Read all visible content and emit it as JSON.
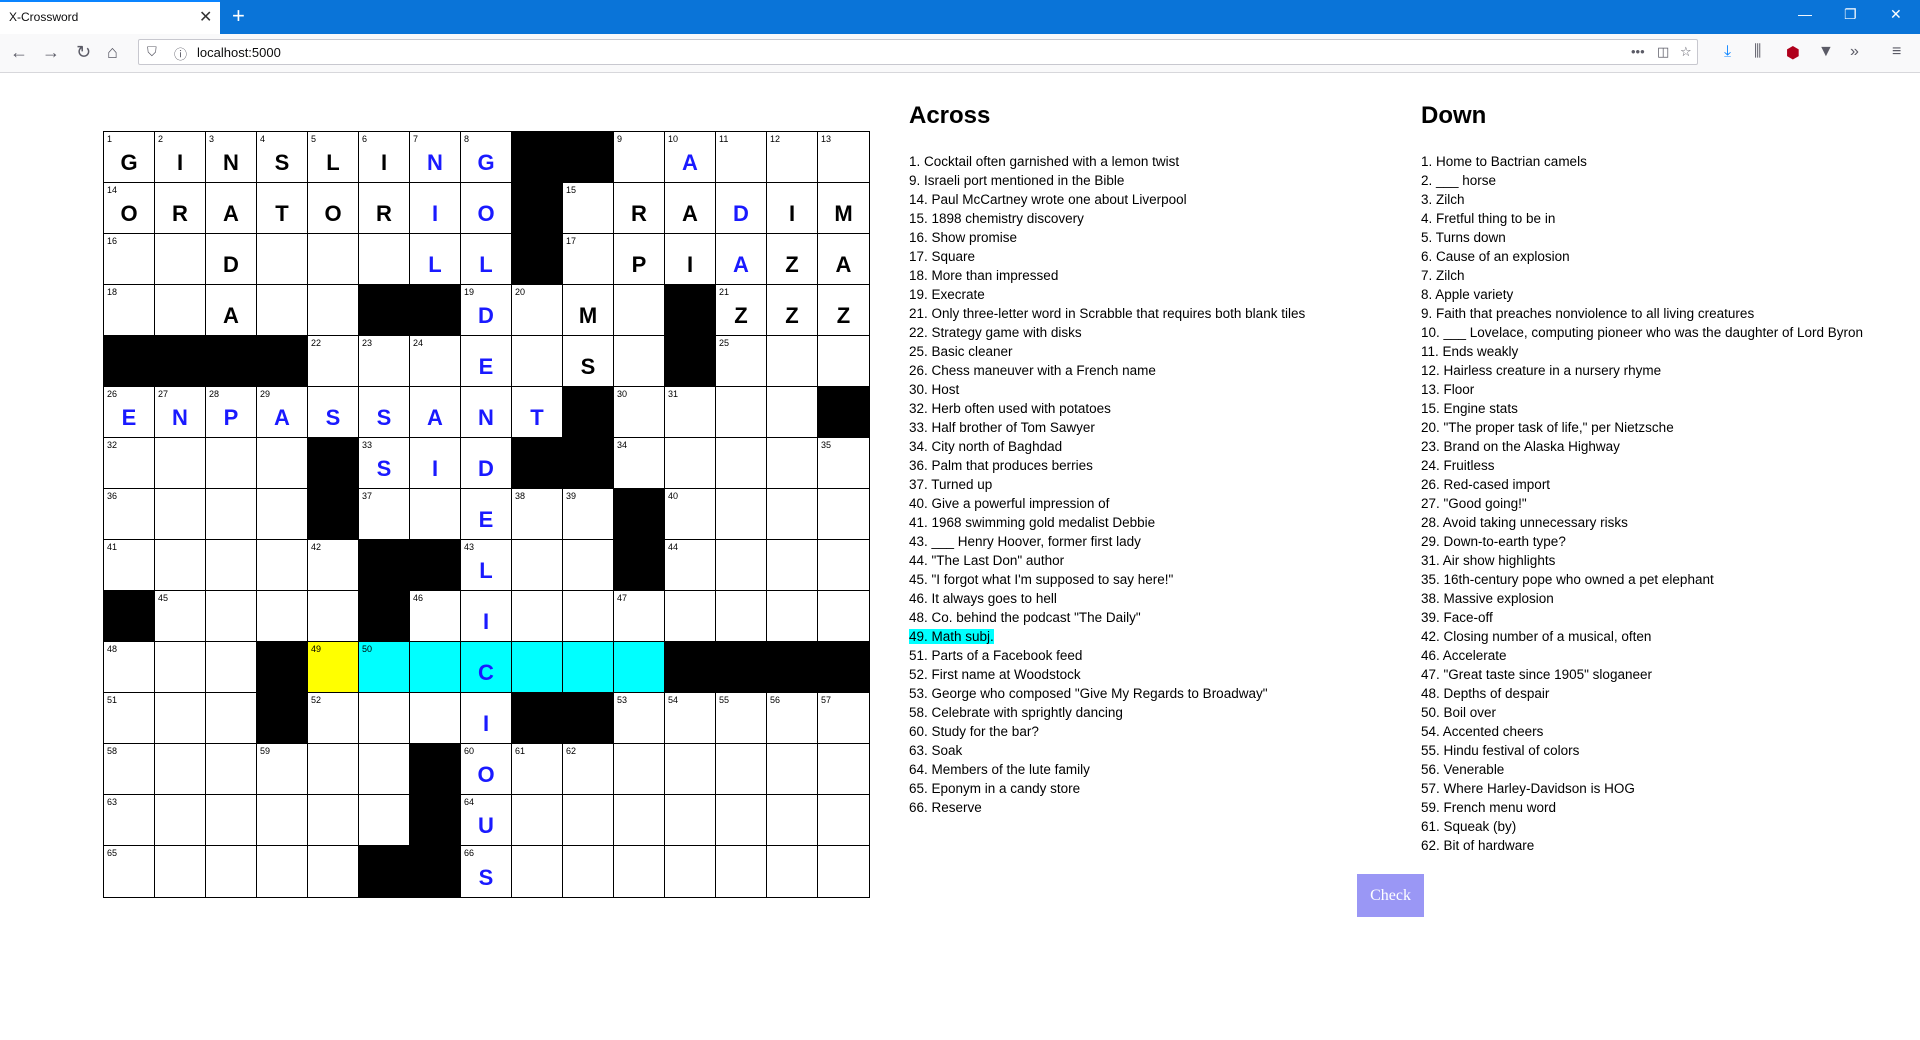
{
  "browser": {
    "tab_title": "X-Crossword",
    "tab_close": "✕",
    "new_tab": "+",
    "url": "localhost:5000",
    "controls": {
      "minimize": "—",
      "restore": "❐",
      "close": "✕"
    }
  },
  "grid": {
    "rows": [
      "GINSLING#.A...",
      "ORATORIO#RADIUM",
      "..D...LL#PIAZZA",
      "..A..##D.M.#ZZZ",
      "####...E.S.#...",
      "ENPASSANT#....#",
      "....#SID##.....",
      "....#..E..#....",
      "....#.#L..#....",
      "#.....I........",
      ".........#####",
      "...#..I##......",
      ".....#O........",
      ".....#U........",
      ".....##S......."
    ],
    "numbers": [
      [
        1,
        2,
        3,
        4,
        5,
        6,
        7,
        8,
        0,
        0,
        9,
        10,
        11,
        12,
        13
      ],
      [
        14,
        0,
        0,
        0,
        0,
        0,
        0,
        0,
        0,
        15,
        0,
        0,
        0,
        0,
        0
      ],
      [
        16,
        0,
        0,
        0,
        0,
        0,
        0,
        0,
        0,
        17,
        0,
        0,
        0,
        0,
        0
      ],
      [
        18,
        0,
        0,
        0,
        0,
        0,
        0,
        19,
        20,
        0,
        0,
        0,
        21,
        0,
        0
      ],
      [
        0,
        0,
        0,
        0,
        22,
        23,
        24,
        0,
        0,
        0,
        0,
        0,
        25,
        0,
        0
      ],
      [
        26,
        27,
        28,
        29,
        0,
        0,
        0,
        0,
        0,
        0,
        30,
        31,
        0,
        0,
        0
      ],
      [
        32,
        0,
        0,
        0,
        0,
        33,
        0,
        0,
        0,
        0,
        34,
        0,
        0,
        0,
        35
      ],
      [
        36,
        0,
        0,
        0,
        0,
        37,
        0,
        0,
        38,
        39,
        0,
        40,
        0,
        0,
        0
      ],
      [
        41,
        0,
        0,
        0,
        42,
        0,
        0,
        43,
        0,
        0,
        0,
        44,
        0,
        0,
        0
      ],
      [
        0,
        45,
        0,
        0,
        0,
        0,
        46,
        0,
        0,
        0,
        47,
        0,
        0,
        0,
        0
      ],
      [
        48,
        0,
        0,
        0,
        49,
        50,
        0,
        0,
        0,
        0,
        0,
        0,
        0,
        0,
        0
      ],
      [
        51,
        0,
        0,
        0,
        52,
        0,
        0,
        0,
        0,
        0,
        53,
        54,
        55,
        56,
        57
      ],
      [
        58,
        0,
        0,
        59,
        0,
        0,
        0,
        60,
        61,
        62,
        0,
        0,
        0,
        0,
        0
      ],
      [
        63,
        0,
        0,
        0,
        0,
        0,
        0,
        64,
        0,
        0,
        0,
        0,
        0,
        0,
        0
      ],
      [
        65,
        0,
        0,
        0,
        0,
        0,
        0,
        66,
        0,
        0,
        0,
        0,
        0,
        0,
        0
      ]
    ],
    "black": [
      [
        0,
        8
      ],
      [
        0,
        9
      ],
      [
        1,
        8
      ],
      [
        2,
        8
      ],
      [
        3,
        5
      ],
      [
        3,
        6
      ],
      [
        3,
        11
      ],
      [
        4,
        0
      ],
      [
        4,
        1
      ],
      [
        4,
        2
      ],
      [
        4,
        3
      ],
      [
        4,
        11
      ],
      [
        5,
        9
      ],
      [
        5,
        14
      ],
      [
        6,
        4
      ],
      [
        6,
        8
      ],
      [
        6,
        9
      ],
      [
        7,
        4
      ],
      [
        7,
        10
      ],
      [
        8,
        5
      ],
      [
        8,
        6
      ],
      [
        8,
        10
      ],
      [
        9,
        0
      ],
      [
        9,
        5
      ],
      [
        10,
        3
      ],
      [
        10,
        11
      ],
      [
        10,
        12
      ],
      [
        10,
        13
      ],
      [
        10,
        14
      ],
      [
        11,
        3
      ],
      [
        11,
        8
      ],
      [
        11,
        9
      ],
      [
        12,
        6
      ],
      [
        13,
        6
      ],
      [
        14,
        5
      ],
      [
        14,
        6
      ]
    ],
    "letters": [
      [
        0,
        0,
        "G",
        "b"
      ],
      [
        0,
        1,
        "I",
        "b"
      ],
      [
        0,
        2,
        "N",
        "b"
      ],
      [
        0,
        3,
        "S",
        "b"
      ],
      [
        0,
        4,
        "L",
        "b"
      ],
      [
        0,
        5,
        "I",
        "b"
      ],
      [
        0,
        6,
        "N",
        "u"
      ],
      [
        0,
        7,
        "G",
        "u"
      ],
      [
        0,
        11,
        "A",
        "u"
      ],
      [
        1,
        0,
        "O",
        "b"
      ],
      [
        1,
        1,
        "R",
        "b"
      ],
      [
        1,
        2,
        "A",
        "b"
      ],
      [
        1,
        3,
        "T",
        "b"
      ],
      [
        1,
        4,
        "O",
        "b"
      ],
      [
        1,
        5,
        "R",
        "b"
      ],
      [
        1,
        6,
        "I",
        "u"
      ],
      [
        1,
        7,
        "O",
        "u"
      ],
      [
        1,
        10,
        "R",
        "b"
      ],
      [
        1,
        11,
        "A",
        "b"
      ],
      [
        1,
        12,
        "D",
        "u"
      ],
      [
        1,
        13,
        "I",
        "b"
      ],
      [
        1,
        14,
        "U",
        "b"
      ],
      [
        1,
        15,
        "M",
        "b"
      ],
      [
        2,
        2,
        "D",
        "b"
      ],
      [
        2,
        6,
        "L",
        "u"
      ],
      [
        2,
        7,
        "L",
        "u"
      ],
      [
        2,
        10,
        "P",
        "b"
      ],
      [
        2,
        11,
        "I",
        "b"
      ],
      [
        2,
        12,
        "A",
        "u"
      ],
      [
        2,
        13,
        "Z",
        "b"
      ],
      [
        2,
        14,
        "Z",
        "b"
      ],
      [
        2,
        15,
        "A",
        "b"
      ],
      [
        3,
        2,
        "A",
        "b"
      ],
      [
        3,
        7,
        "D",
        "u"
      ],
      [
        3,
        9,
        "M",
        "b"
      ],
      [
        3,
        12,
        "Z",
        "b"
      ],
      [
        3,
        13,
        "Z",
        "b"
      ],
      [
        3,
        14,
        "Z",
        "b"
      ],
      [
        4,
        7,
        "E",
        "u"
      ],
      [
        4,
        9,
        "S",
        "b"
      ],
      [
        5,
        0,
        "E",
        "u"
      ],
      [
        5,
        1,
        "N",
        "u"
      ],
      [
        5,
        2,
        "P",
        "u"
      ],
      [
        5,
        3,
        "A",
        "u"
      ],
      [
        5,
        4,
        "S",
        "u"
      ],
      [
        5,
        5,
        "S",
        "u"
      ],
      [
        5,
        6,
        "A",
        "u"
      ],
      [
        5,
        7,
        "N",
        "u"
      ],
      [
        5,
        8,
        "T",
        "u"
      ],
      [
        6,
        5,
        "S",
        "u"
      ],
      [
        6,
        6,
        "I",
        "u"
      ],
      [
        6,
        7,
        "D",
        "u"
      ],
      [
        7,
        7,
        "E",
        "u"
      ],
      [
        8,
        7,
        "L",
        "u"
      ],
      [
        9,
        7,
        "I",
        "u"
      ],
      [
        10,
        7,
        "C",
        "u"
      ],
      [
        11,
        7,
        "I",
        "u"
      ],
      [
        12,
        7,
        "O",
        "u"
      ],
      [
        13,
        7,
        "U",
        "u"
      ],
      [
        14,
        7,
        "S",
        "u"
      ]
    ],
    "current_cell": [
      10,
      4
    ],
    "highlight": [
      [
        10,
        5
      ],
      [
        10,
        6
      ],
      [
        10,
        7
      ],
      [
        10,
        8
      ],
      [
        10,
        9
      ],
      [
        10,
        10
      ]
    ]
  },
  "across": {
    "title": "Across",
    "clues": [
      "1. Cocktail often garnished with a lemon twist",
      "9. Israeli port mentioned in the Bible",
      "14. Paul McCartney wrote one about Liverpool",
      "15. 1898 chemistry discovery",
      "16. Show promise",
      "17. Square",
      "18. More than impressed",
      "19. Execrate",
      "21. Only three-letter word in Scrabble that requires both blank tiles",
      "22. Strategy game with disks",
      "25. Basic cleaner",
      "26. Chess maneuver with a French name",
      "30. Host",
      "32. Herb often used with potatoes",
      "33. Half brother of Tom Sawyer",
      "34. City north of Baghdad",
      "36. Palm that produces berries",
      "37. Turned up",
      "40. Give a powerful impression of",
      "41. 1968 swimming gold medalist Debbie",
      "43. ___ Henry Hoover, former first lady",
      "44. \"The Last Don\" author",
      "45. \"I forgot what I'm supposed to say here!\"",
      "46. It always goes to hell",
      "48. Co. behind the podcast \"The Daily\"",
      "49. Math subj.",
      "51. Parts of a Facebook feed",
      "52. First name at Woodstock",
      "53. George who composed \"Give My Regards to Broadway\"",
      "58. Celebrate with sprightly dancing",
      "60. Study for the bar?",
      "63. Soak",
      "64. Members of the lute family",
      "65. Eponym in a candy store",
      "66. Reserve"
    ],
    "active_index": 25
  },
  "down": {
    "title": "Down",
    "clues": [
      "1. Home to Bactrian camels",
      "2. ___ horse",
      "3. Zilch",
      "4. Fretful thing to be in",
      "5. Turns down",
      "6. Cause of an explosion",
      "7. Zilch",
      "8. Apple variety",
      "9. Faith that preaches nonviolence to all living creatures",
      "10. ___ Lovelace, computing pioneer who was the daughter of Lord Byron",
      "11. Ends weakly",
      "12. Hairless creature in a nursery rhyme",
      "13. Floor",
      "15. Engine stats",
      "20. \"The proper task of life,\" per Nietzsche",
      "23. Brand on the Alaska Highway",
      "24. Fruitless",
      "26. Red-cased import",
      "27. \"Good going!\"",
      "28. Avoid taking unnecessary risks",
      "29. Down-to-earth type?",
      "31. Air show highlights",
      "35. 16th-century pope who owned a pet elephant",
      "38. Massive explosion",
      "39. Face-off",
      "42. Closing number of a musical, often",
      "46. Accelerate",
      "47. \"Great taste since 1905\" sloganeer",
      "48. Depths of despair",
      "50. Boil over",
      "54. Accented cheers",
      "55. Hindu festival of colors",
      "56. Venerable",
      "57. Where Harley-Davidson is HOG",
      "59. French menu word",
      "61. Squeak (by)",
      "62. Bit of hardware"
    ]
  },
  "check_label": "Check",
  "colors": {
    "highlight": "#00ffff",
    "current": "#ffff00",
    "user_letter": "#1a1aff",
    "button": "#9a97f5"
  }
}
